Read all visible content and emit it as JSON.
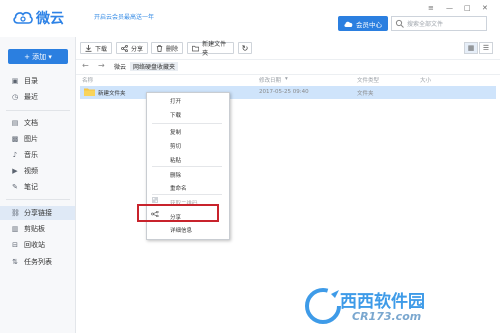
{
  "header": {
    "app_name": "微云",
    "promo": "开启云会员最高送一年",
    "vip_label": "会员中心",
    "search_placeholder": "搜索全部文件",
    "window_controls": [
      "≡",
      "—",
      "□",
      "✕"
    ]
  },
  "sidebar": {
    "add_label": "+ 添加  ▾",
    "items": [
      {
        "icon": "▣",
        "label": "目录"
      },
      {
        "icon": "◷",
        "label": "最近"
      },
      {
        "icon": "▤",
        "label": "文档"
      },
      {
        "icon": "▩",
        "label": "图片"
      },
      {
        "icon": "♪",
        "label": "音乐"
      },
      {
        "icon": "▶",
        "label": "视频"
      },
      {
        "icon": "✎",
        "label": "笔记"
      },
      {
        "icon": "⛓",
        "label": "分享链接"
      },
      {
        "icon": "▥",
        "label": "剪贴板"
      },
      {
        "icon": "⊟",
        "label": "回收站"
      },
      {
        "icon": "⇅",
        "label": "任务列表"
      }
    ],
    "active_index": 7
  },
  "toolbar": {
    "download": "下载",
    "share": "分享",
    "delete": "删除",
    "new_folder": "新建文件夹",
    "refresh": "↻",
    "grid_icon": "▦",
    "list_icon": "☰"
  },
  "breadcrumb": {
    "back": "←",
    "forward": "→",
    "root": "微云",
    "current": "网络硬盘收藏夹"
  },
  "columns": {
    "name": "名称",
    "modified": "修改日期",
    "sort_icon": "▾",
    "type": "文件类型",
    "size": "大小"
  },
  "files": [
    {
      "name": "新建文件夹",
      "modified": "2017-05-25 09:40",
      "type": "文件夹",
      "size": ""
    }
  ],
  "context_menu": {
    "items": [
      "打开",
      "下载",
      "复制",
      "剪切",
      "粘贴",
      "删除",
      "重命名",
      "获取二维码",
      "分享",
      "详细信息"
    ],
    "disabled": [
      "获取二维码"
    ],
    "highlighted": "分享"
  },
  "watermark": {
    "text1": "西西软件园",
    "text2": "CR173.com"
  },
  "colors": {
    "accent": "#2b7fe0",
    "selection": "#cfe4fb",
    "highlight_border": "#c8232c"
  }
}
